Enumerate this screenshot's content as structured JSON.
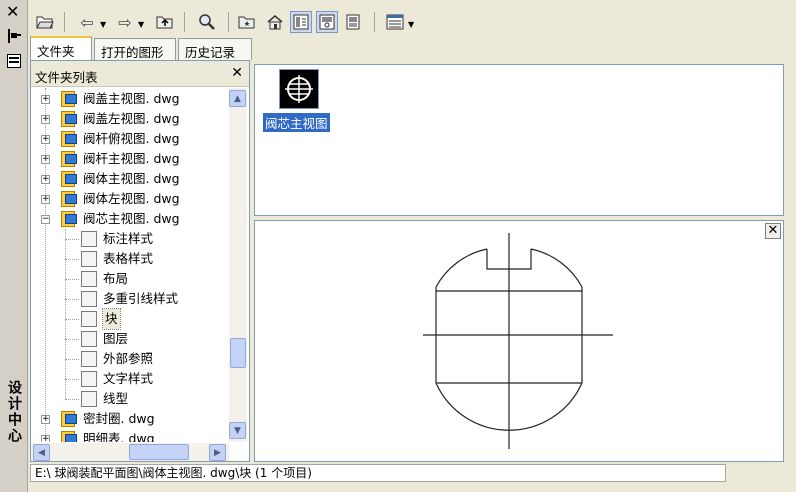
{
  "panel": {
    "title": "设计中心"
  },
  "toolbar": {
    "buttons": [
      "load-icon",
      "back-icon",
      "forward-icon",
      "up-icon",
      "search-icon",
      "favorites-icon",
      "home-icon",
      "tree-toggle-icon",
      "preview-icon",
      "description-icon",
      "views-icon"
    ]
  },
  "tabs": [
    {
      "label": "文件夹",
      "active": true
    },
    {
      "label": "打开的图形",
      "active": false
    },
    {
      "label": "历史记录",
      "active": false
    }
  ],
  "tree": {
    "header": "文件夹列表",
    "files_top": [
      "阀盖主视图. dwg",
      "阀盖左视图. dwg",
      "阀杆俯视图. dwg",
      "阀杆主视图. dwg",
      "阀体主视图. dwg",
      "阀体左视图. dwg",
      "阀芯主视图. dwg"
    ],
    "children": [
      "标注样式",
      "表格样式",
      "布局",
      "多重引线样式",
      "块",
      "图层",
      "外部参照",
      "文字样式",
      "线型"
    ],
    "selected_child": "块",
    "files_bottom": [
      "密封圈. dwg",
      "明细表. dwg"
    ]
  },
  "content": {
    "item_label": "阀芯主视图"
  },
  "status": {
    "path": "E:\\ 球阀装配平面图\\阀体主视图. dwg\\块  (1 个项目)"
  }
}
